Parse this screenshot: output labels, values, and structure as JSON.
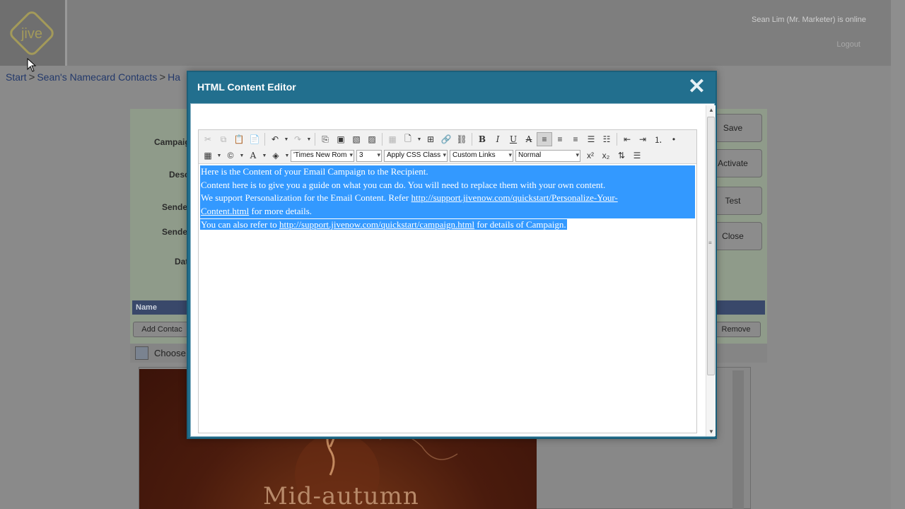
{
  "header": {
    "online_text": "Sean Lim (Mr. Marketer) is online",
    "logout_label": "Logout",
    "logo_text": "jive"
  },
  "breadcrumb": {
    "items": [
      "Start",
      "Sean's Namecard Contacts",
      "Ha"
    ]
  },
  "form": {
    "labels": [
      "Campaig",
      "Desc",
      "Sende",
      "Sende",
      "Dat"
    ]
  },
  "side_buttons": {
    "save": "Save",
    "activate": "Activate",
    "test": "Test",
    "close": "Close"
  },
  "table": {
    "name_header": "Name",
    "add_contact_label": "Add Contac",
    "remove_label": "Remove"
  },
  "choose_row": {
    "label": "Choose"
  },
  "preview": {
    "title": "Mid-autumn"
  },
  "modal": {
    "title": "HTML Content Editor",
    "close_glyph": "✕"
  },
  "toolbar": {
    "font_name": "'Times New Rom",
    "font_size": "3",
    "css_class": "Apply CSS Class",
    "custom_links": "Custom Links",
    "paragraph": "Normal"
  },
  "content": {
    "line1": "Here is the Content of your Email Campaign to the Recipient.",
    "line2": "Content here is to give you a guide on what you can do. You will need to replace them with your own content.",
    "line3_pre": "We support Personalization for the Email Content. Refer ",
    "line3_link": "http://support.jivenow.com/quickstart/Personalize-Your-",
    "line4_link": "Content.html",
    "line4_post": " for more details.",
    "line5_pre": "You can also refer to ",
    "line5_link": "http://support.jivenow.com/quickstart/campaign.html",
    "line5_post": " for details of Campaign."
  },
  "colors": {
    "modal_header": "#226f8e",
    "selection": "#3399ff",
    "breadcrumb_link": "#23396b"
  }
}
